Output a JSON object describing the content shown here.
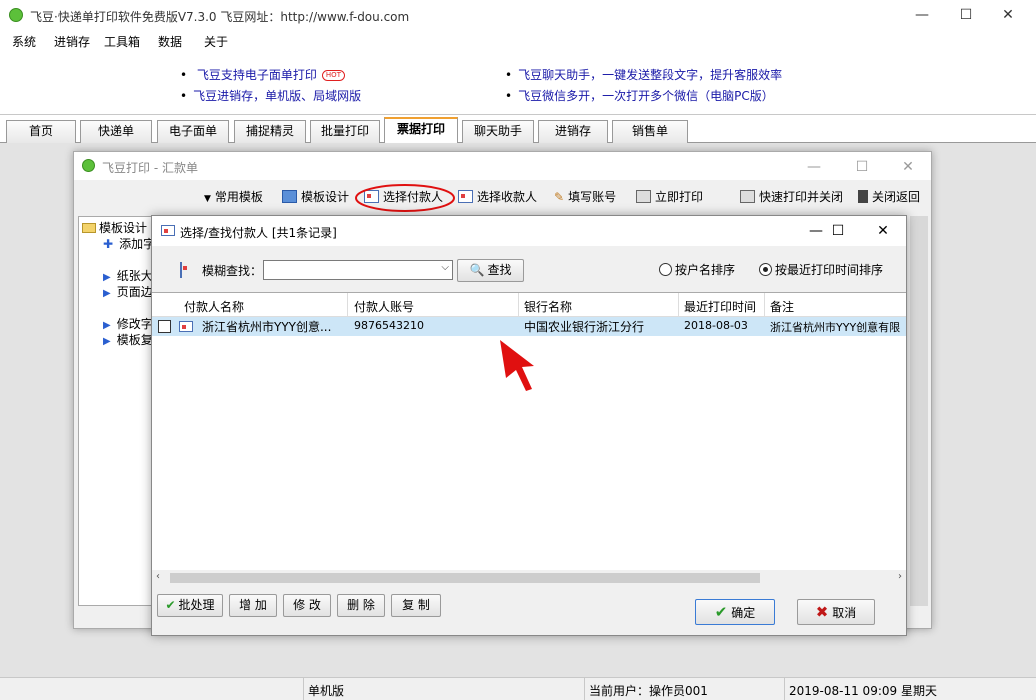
{
  "app": {
    "title": "飞豆·快递单打印软件免费版V7.3.0   飞豆网址：http://www.f-dou.com",
    "min": "—",
    "max": "☐",
    "close": "✕"
  },
  "menu": [
    "系统",
    "进销存",
    "工具箱",
    "数据",
    "关于"
  ],
  "promo": {
    "left1": "飞豆支持电子面单打印",
    "hot": "HOT",
    "left2": "飞豆进销存，单机版、局域网版",
    "right1": "飞豆聊天助手，一键发送整段文字，提升客服效率",
    "right2": "飞豆微信多开，一次打开多个微信（电脑PC版）"
  },
  "tabs": [
    "首页",
    "快递单",
    "电子面单",
    "捕捉精灵",
    "批量打印",
    "票据打印",
    "聊天助手",
    "进销存",
    "销售单"
  ],
  "active_tab": "票据打印",
  "win1": {
    "title": "飞豆打印 - 汇款单",
    "toolbar": [
      "常用模板",
      "模板设计",
      "选择付款人",
      "选择收款人",
      "填写账号",
      "立即打印",
      "快速打印并关闭",
      "关闭返回"
    ],
    "left_panel": [
      "模板设计",
      "添加字",
      "纸张大",
      "页面边",
      "修改字",
      "模板复"
    ]
  },
  "dialog": {
    "title": "选择/查找付款人  [共1条记录]",
    "search_label": "模糊查找：",
    "search_value": "",
    "search_button": "查找",
    "radio_name": "按户名排序",
    "radio_time": "按最近打印时间排序",
    "columns": [
      "付款人名称",
      "付款人账号",
      "银行名称",
      "最近打印时间",
      "备注"
    ],
    "rows": [
      {
        "name": "浙江省杭州市YYY创意...",
        "account": "9876543210",
        "bank": "中国农业银行浙江分行",
        "last_print": "2018-08-03",
        "remark": "浙江省杭州市YYY创意有限"
      }
    ],
    "buttons": {
      "batch": "批处理",
      "add": "增 加",
      "edit": "修 改",
      "delete": "删 除",
      "copy": "复 制",
      "ok": "确定",
      "cancel": "取消"
    }
  },
  "status": {
    "mode": "单机版",
    "user": "当前用户：操作员001",
    "datetime": "2019-08-11 09:09 星期天"
  },
  "colors": {
    "highlight": "#cde6f7",
    "annotation": "#e01010",
    "link": "#1a1aa8"
  }
}
